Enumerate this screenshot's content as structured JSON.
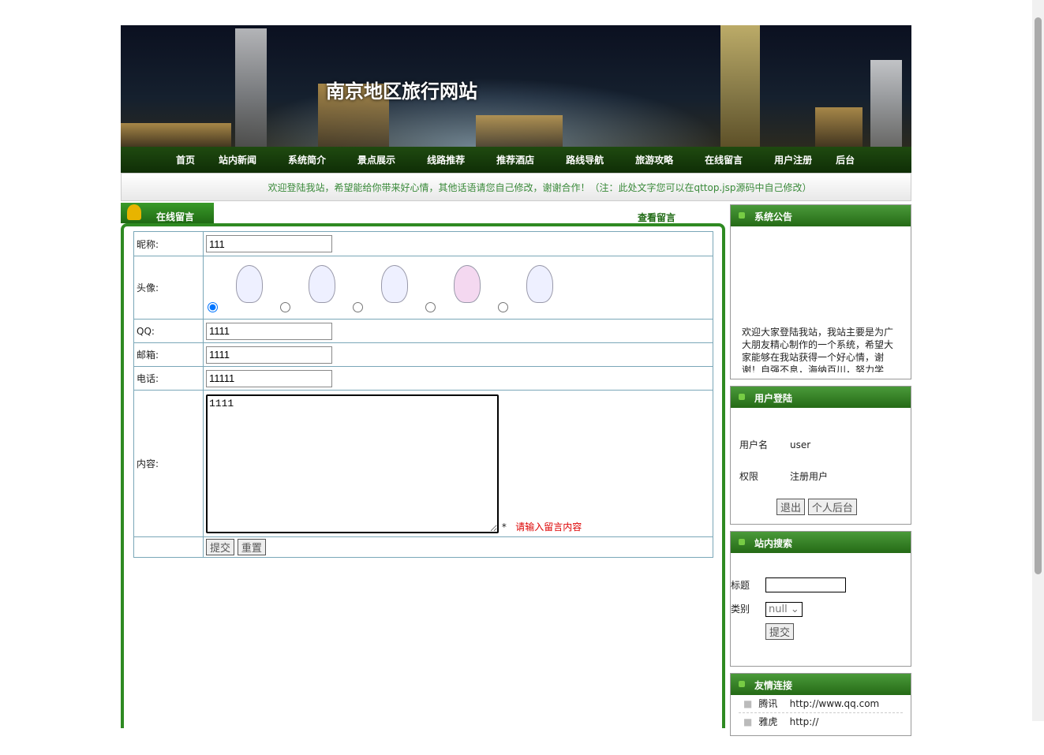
{
  "banner": {
    "title": "南京地区旅行网站"
  },
  "nav": [
    "首页",
    "站内新闻",
    "系统简介",
    "景点展示",
    "线路推荐",
    "推荐酒店",
    "路线导航",
    "旅游攻略",
    "在线留言",
    "用户注册",
    "后台"
  ],
  "marquee": "欢迎登陆我站，希望能给你带来好心情，其他话语请您自己修改，谢谢合作！（注：此处文字您可以在qttop.jsp源码中自己修改）",
  "main": {
    "tab": "在线留言",
    "view_link": "查看留言",
    "form": {
      "nickname_label": "昵称:",
      "nickname": "111",
      "avatar_label": "头像:",
      "qq_label": "QQ:",
      "qq": "1111",
      "email_label": "邮箱:",
      "email": "1111",
      "phone_label": "电话:",
      "phone": "11111",
      "content_label": "内容:",
      "content": "1111",
      "required_mark": "*",
      "content_hint": "请输入留言内容",
      "submit": "提交",
      "reset": "重置",
      "avatar_selected": 1
    }
  },
  "sidebar": {
    "notice": {
      "title": "系统公告",
      "text": "欢迎大家登陆我站，我站主要是为广大朋友精心制作的一个系统，希望大家能够在我站获得一个好心情，谢谢！自强不息，海纳百川，努力学"
    },
    "login": {
      "title": "用户登陆",
      "username_label": "用户名",
      "username": "user",
      "role_label": "权限",
      "role": "注册用户",
      "logout": "退出",
      "personal": "个人后台"
    },
    "search": {
      "title": "站内搜索",
      "title_label": "标题",
      "title_value": "",
      "category_label": "类别",
      "category": "null",
      "submit": "提交"
    },
    "links": {
      "title": "友情连接",
      "items": [
        {
          "name": "腾讯",
          "url": "http://www.qq.com"
        },
        {
          "name": "雅虎",
          "url": "http://"
        }
      ]
    }
  }
}
